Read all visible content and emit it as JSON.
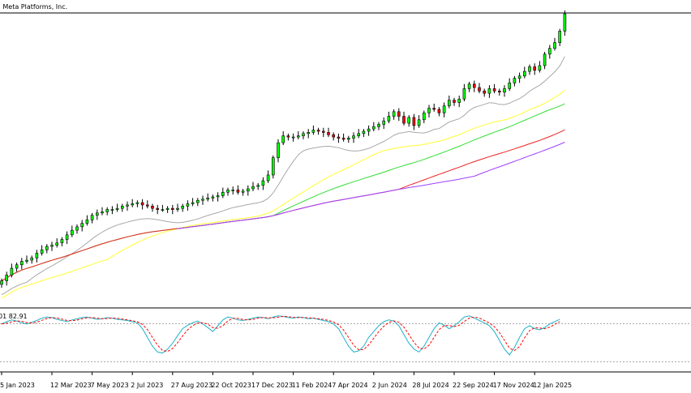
{
  "header": {
    "title": "y: Meta Platforms, Inc."
  },
  "stoch_label": "01 82.91",
  "colors": {
    "up": "#00ff00",
    "down": "#ff0000",
    "wick": "#000000",
    "ma_fast": "#a8a8a8",
    "ma_yellow": "#ffff33",
    "ma_green": "#33dd33",
    "ma_red": "#ee2222",
    "ma_purple": "#a040ff",
    "stoch_main": "#20b2c8",
    "stoch_signal": "#ff0000",
    "border": "#000000",
    "level": "#aaaaaa"
  },
  "chart_data": [
    {
      "type": "candlestick",
      "timeframe": "weekly",
      "x_tick_labels": [
        "5 Jan 2023",
        "12 Mar 2023",
        "7 May 2023",
        "2 Jul 2023",
        "27 Aug 2023",
        "22 Oct 2023",
        "17 Dec 2023",
        "11 Feb 2024",
        "7 Apr 2024",
        "2 Jun 2024",
        "28 Jul 2024",
        "22 Sep 2024",
        "17 Nov 2024",
        "12 Jan 2025"
      ],
      "x_tick_index": [
        0,
        10,
        18,
        26,
        34,
        42,
        50,
        58,
        66,
        74,
        82,
        90,
        98,
        106
      ],
      "ylim": [
        0,
        100
      ],
      "close": [
        3,
        8,
        14,
        17,
        20,
        21,
        23,
        27,
        30,
        33,
        34,
        36,
        39,
        43,
        47,
        50,
        53,
        56,
        60,
        62,
        63,
        65,
        65,
        66,
        68,
        69,
        70,
        71,
        69,
        68,
        66,
        65,
        65,
        66,
        65,
        66,
        68,
        70,
        71,
        73,
        74,
        75,
        76,
        77,
        80,
        82,
        82,
        80,
        81,
        83,
        85,
        86,
        90,
        95,
        110,
        123,
        129,
        128,
        128,
        129,
        131,
        132,
        134,
        133,
        132,
        130,
        128,
        127,
        126,
        127,
        129,
        131,
        133,
        135,
        137,
        139,
        142,
        146,
        150,
        146,
        140,
        145,
        138,
        143,
        149,
        153,
        152,
        149,
        155,
        160,
        158,
        161,
        170,
        174,
        171,
        168,
        166,
        170,
        168,
        167,
        170,
        175,
        179,
        181,
        185,
        189,
        186,
        190,
        200,
        205,
        210,
        220,
        235
      ],
      "series": [
        {
          "name": "",
          "values_note": "moving averages (fast, yellow, green, red, purple) computed from close"
        }
      ]
    },
    {
      "type": "line",
      "indicator": "stochastic",
      "ylim": [
        0,
        100
      ],
      "levels": [
        80,
        20
      ],
      "values": [
        78,
        82,
        85,
        83,
        80,
        78,
        81,
        84,
        88,
        90,
        89,
        86,
        84,
        82,
        85,
        87,
        89,
        90,
        88,
        86,
        87,
        89,
        88,
        86,
        85,
        84,
        82,
        80,
        70,
        55,
        40,
        30,
        28,
        35,
        45,
        58,
        70,
        76,
        80,
        83,
        78,
        72,
        65,
        75,
        85,
        90,
        88,
        85,
        84,
        86,
        88,
        90,
        89,
        87,
        90,
        92,
        91,
        89,
        88,
        90,
        89,
        87,
        88,
        86,
        84,
        82,
        78,
        70,
        55,
        40,
        30,
        32,
        40,
        55,
        65,
        75,
        82,
        85,
        83,
        75,
        60,
        45,
        35,
        30,
        40,
        55,
        70,
        80,
        76,
        70,
        75,
        82,
        90,
        92,
        88,
        84,
        80,
        75,
        65,
        50,
        35,
        25,
        38,
        55,
        70,
        75,
        70,
        68,
        72,
        78,
        82,
        86
      ]
    }
  ]
}
